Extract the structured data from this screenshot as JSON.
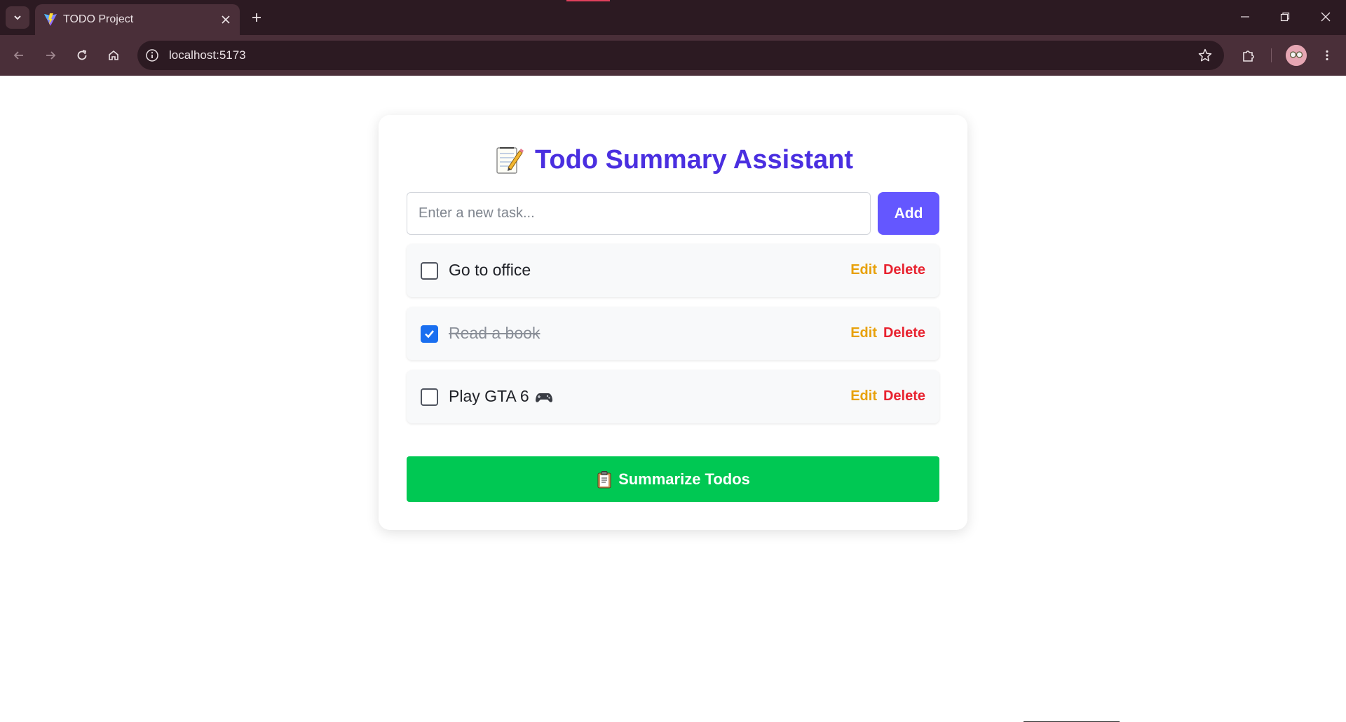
{
  "browser": {
    "tab_title": "TODO Project",
    "url": "localhost:5173"
  },
  "app": {
    "title": "Todo Summary Assistant",
    "input_placeholder": "Enter a new task...",
    "input_value": "",
    "add_label": "Add",
    "summarize_label": "Summarize Todos",
    "colors": {
      "title": "#4a2fe0",
      "add_button": "#6457ff",
      "summarize_button": "#00c853",
      "edit": "#e8a10a",
      "delete": "#e8222f",
      "checkbox_checked": "#1a6ff0"
    },
    "todos": [
      {
        "text": "Go to office",
        "done": false,
        "edit_label": "Edit",
        "delete_label": "Delete"
      },
      {
        "text": "Read a book",
        "done": true,
        "edit_label": "Edit",
        "delete_label": "Delete"
      },
      {
        "text": "Play GTA 6",
        "done": false,
        "icon": "game-controller-icon",
        "edit_label": "Edit",
        "delete_label": "Delete"
      }
    ]
  }
}
